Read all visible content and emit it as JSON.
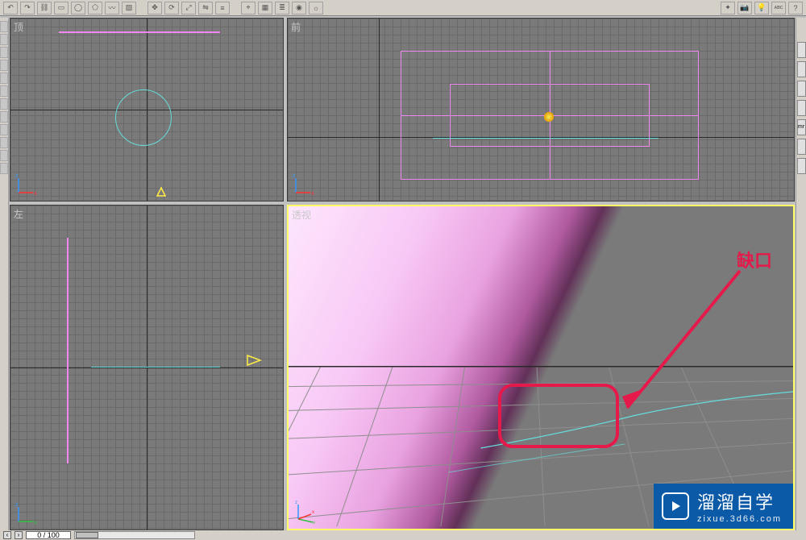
{
  "toolbar": {
    "icons": [
      "undo",
      "redo",
      "link",
      "sel-rect",
      "sel-circ",
      "sel-poly",
      "sel-lasso",
      "sel-win",
      "move",
      "rotate",
      "scale",
      "mirror",
      "align",
      "snap",
      "grid",
      "layers",
      "mat",
      "render",
      "fx",
      "cam",
      "light",
      "help"
    ]
  },
  "viewports": {
    "top": {
      "label": "顶"
    },
    "front": {
      "label": "前"
    },
    "left": {
      "label": "左"
    },
    "persp": {
      "label": "透视"
    }
  },
  "annotation": {
    "gap_label": "缺口"
  },
  "timeline": {
    "frame_display": "0 / 100"
  },
  "right_panel": {
    "mr_badge": "mr"
  },
  "watermark": {
    "title": "溜溜自学",
    "url": "zixue.3d66.com"
  },
  "colors": {
    "accent_red": "#e6194b",
    "wm_blue": "#0a5aa8",
    "wire_pink": "#ee88ee",
    "wire_cyan": "#66dddd"
  }
}
